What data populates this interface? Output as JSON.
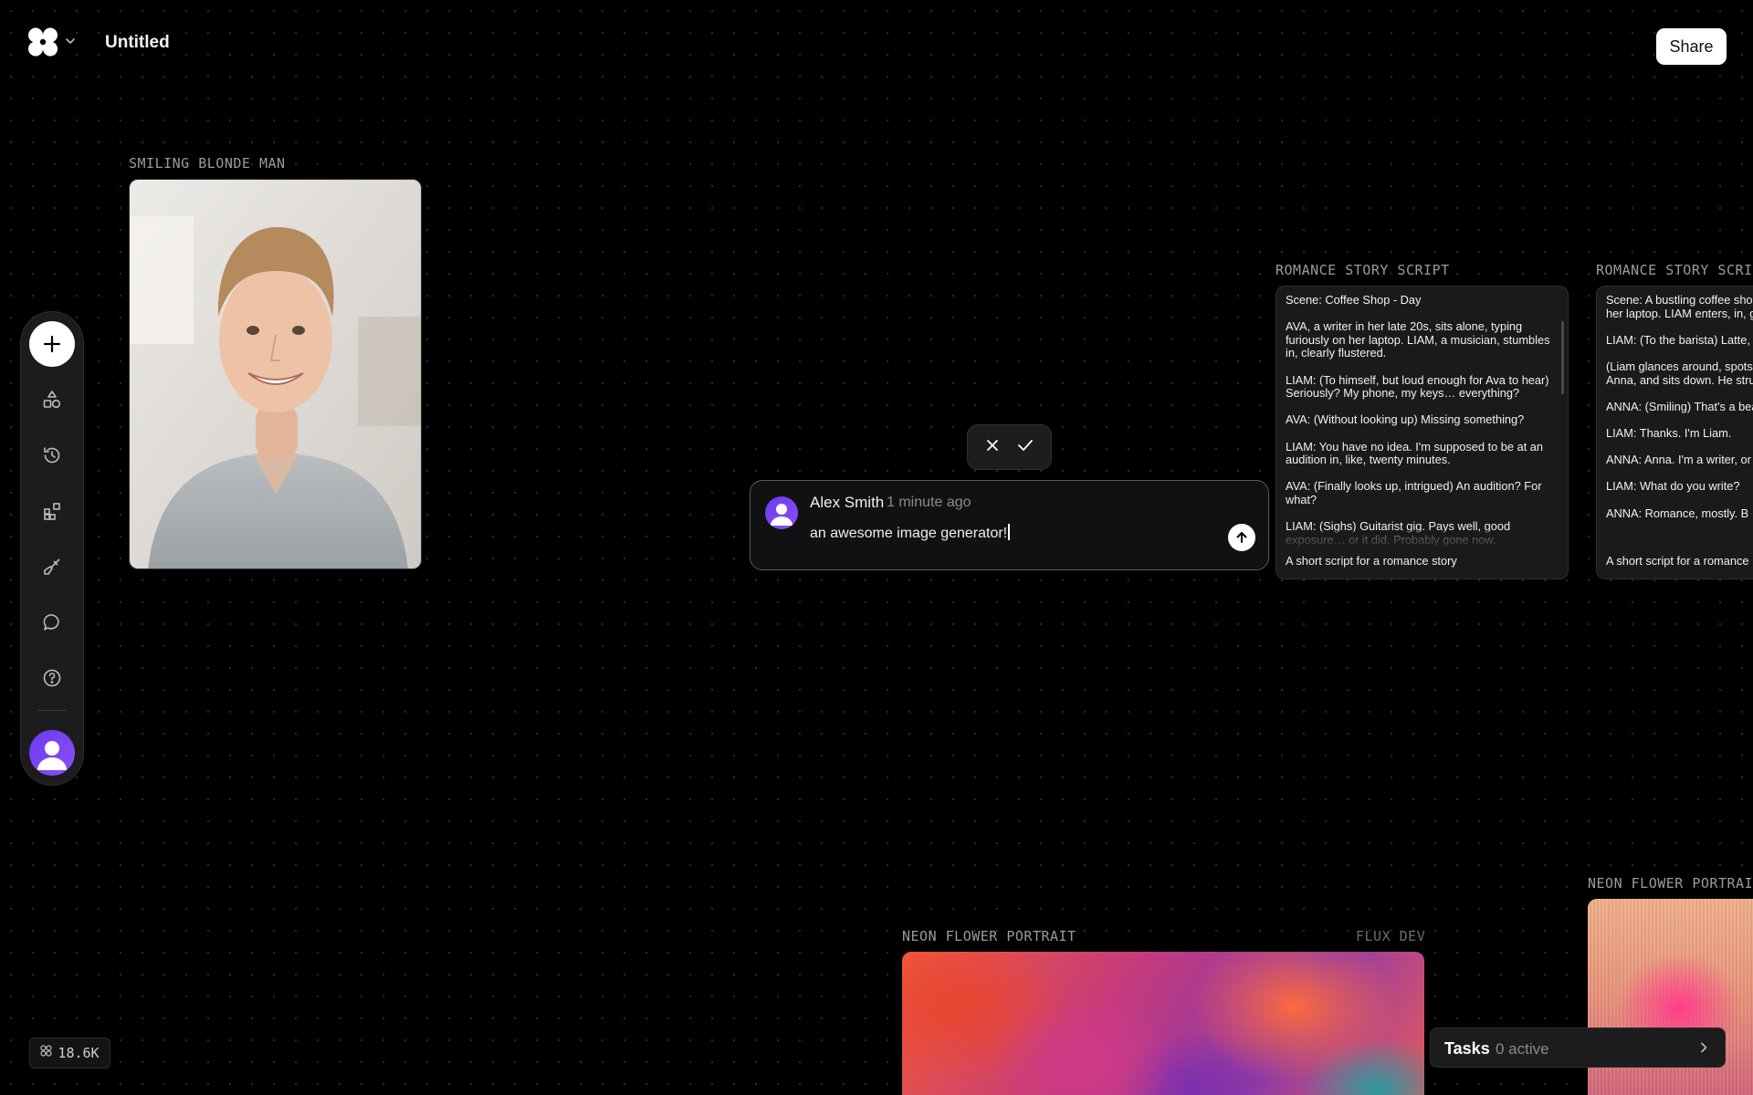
{
  "header": {
    "title": "Untitled",
    "share_label": "Share"
  },
  "toolbar": {
    "items": [
      "add-icon",
      "shapes-icon",
      "history-icon",
      "apps-icon",
      "brush-icon",
      "chat-icon",
      "help-icon",
      "avatar"
    ]
  },
  "nodes": {
    "portrait": {
      "label": "SMILING BLONDE MAN"
    },
    "script1": {
      "label": "ROMANCE STORY SCRIPT",
      "lines": [
        "Scene: Coffee Shop - Day",
        "AVA, a writer in her late 20s, sits alone, typing furiously on her laptop. LIAM, a musician, stumbles in, clearly flustered.",
        "LIAM: (To himself, but loud enough for Ava to hear) Seriously? My phone, my keys… everything?",
        "AVA: (Without looking up) Missing something?",
        "LIAM: You have no idea. I'm supposed to be at an audition in, like, twenty minutes.",
        "AVA: (Finally looks up, intrigued) An audition? For what?",
        "LIAM: (Sighs) Guitarist gig. Pays well, good exposure… or it did. Probably gone now."
      ],
      "caption": "A short script for a romance story"
    },
    "script2": {
      "label": "ROMANCE STORY SCRIPT",
      "lines": [
        "Scene: A bustling coffee shop. ANNA, engrossed in her laptop. LIAM enters, in, guitar case in hand.",
        "LIAM: (To the barista) Latte, please.",
        "(Liam glances around, spots an empty seat near Anna, and sits down. He strums his guitar.)",
        "ANNA: (Smiling) That's a beautiful tune.",
        "LIAM: Thanks. I'm Liam.",
        "ANNA: Anna. I'm a writer, or",
        "LIAM: What do you write?",
        "ANNA: Romance, mostly. B"
      ],
      "caption": "A short script for a romance"
    },
    "neon1": {
      "label": "NEON FLOWER PORTRAIT",
      "model": "FLUX DEV"
    },
    "neon2": {
      "label": "NEON FLOWER PORTRAIT"
    }
  },
  "comment": {
    "author": "Alex Smith",
    "time": "1 minute ago",
    "text": "an awesome image generator!"
  },
  "tasks": {
    "title": "Tasks",
    "count": "0 active"
  },
  "credits": {
    "value": "18.6K"
  }
}
